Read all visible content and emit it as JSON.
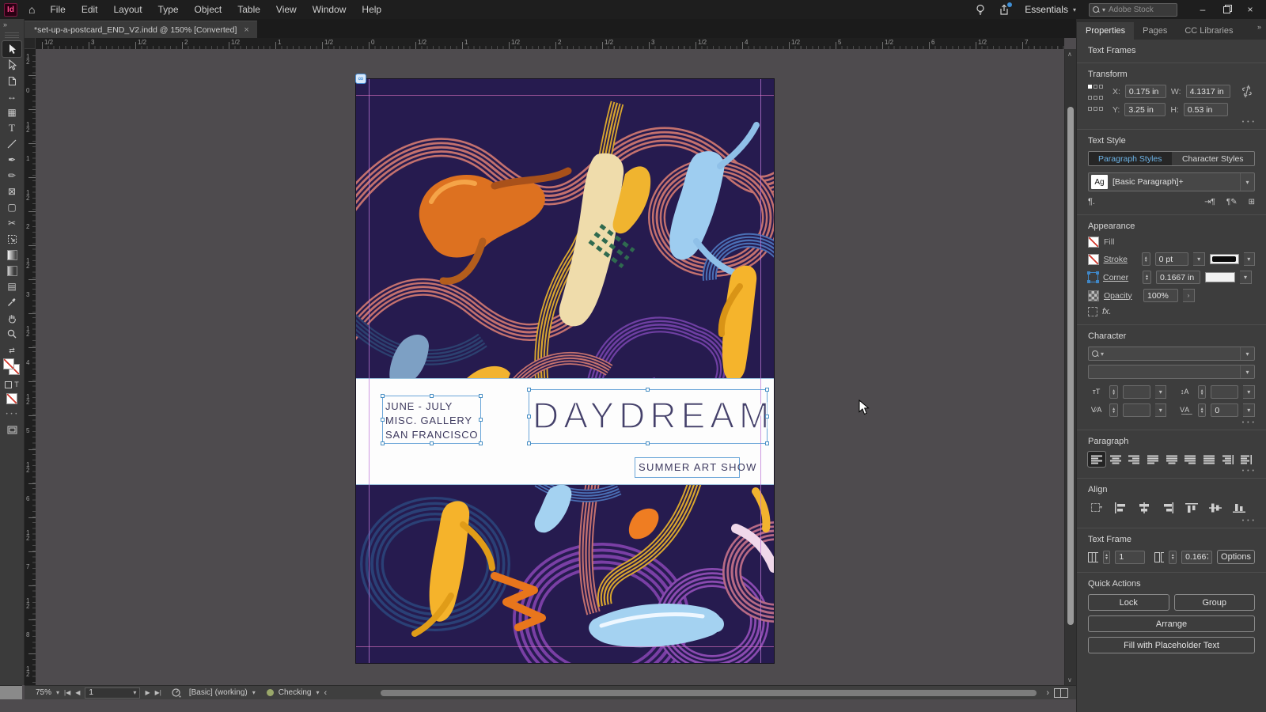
{
  "menu_bar": {
    "menus": [
      "File",
      "Edit",
      "Layout",
      "Type",
      "Object",
      "Table",
      "View",
      "Window",
      "Help"
    ],
    "logo_text": "Id",
    "workspace": "Essentials",
    "search_placeholder": "Adobe Stock"
  },
  "document_tab": {
    "title": "*set-up-a-postcard_END_V2.indd @ 150% [Converted]"
  },
  "rulers": {
    "top": [
      "1/2",
      "3",
      "1/2",
      "2",
      "1/2",
      "1",
      "1/2",
      "0",
      "1/2",
      "1",
      "1/2",
      "2",
      "1/2",
      "3",
      "1/2",
      "4",
      "1/2",
      "5",
      "1/2",
      "6",
      "1/2",
      "7",
      "1/2"
    ],
    "left": [
      "1\n2",
      "0",
      "1\n2",
      "1",
      "1\n2",
      "2",
      "1\n2",
      "3",
      "1\n2",
      "4",
      "1\n2",
      "5",
      "1\n2",
      "6",
      "1\n2",
      "7",
      "1\n2",
      "8",
      "1\n2"
    ]
  },
  "postcard": {
    "date_line": "JUNE - JULY",
    "venue_line": "MISC. GALLERY",
    "city_line": "SAN FRANCISCO",
    "title": "DAYDREAM",
    "subtitle": "SUMMER ART SHOW"
  },
  "panel": {
    "tabs": {
      "properties": "Properties",
      "pages": "Pages",
      "cc_libraries": "CC Libraries"
    },
    "selection_label": "Text Frames",
    "transform": {
      "title": "Transform",
      "x_label": "X:",
      "x": "0.175 in",
      "y_label": "Y:",
      "y": "3.25 in",
      "w_label": "W:",
      "w": "4.1317 in",
      "h_label": "H:",
      "h": "0.53 in"
    },
    "text_style": {
      "title": "Text Style",
      "tab_paragraph": "Paragraph Styles",
      "tab_character": "Character Styles",
      "style_badge": "Ag",
      "style_name": "[Basic Paragraph]+"
    },
    "appearance": {
      "title": "Appearance",
      "fill_label": "Fill",
      "stroke_label": "Stroke",
      "stroke_value": "0 pt",
      "corner_label": "Corner",
      "corner_value": "0.1667 in",
      "opacity_label": "Opacity",
      "opacity_value": "100%"
    },
    "character": {
      "title": "Character",
      "tracking_value": "0"
    },
    "paragraph": {
      "title": "Paragraph"
    },
    "align": {
      "title": "Align"
    },
    "text_frame": {
      "title": "Text Frame",
      "columns_value": "1",
      "gutter_value": "0.1667",
      "options_label": "Options"
    },
    "quick_actions": {
      "title": "Quick Actions",
      "lock": "Lock",
      "group": "Group",
      "arrange": "Arrange",
      "fill_placeholder": "Fill with Placeholder Text"
    }
  },
  "status_bar": {
    "zoom_level": "75%",
    "page_number": "1",
    "preset": "[Basic] (working)",
    "preflight_status": "Checking"
  },
  "glyphs": {
    "chev_down": "▾",
    "dbl_chev": "»",
    "close": "×",
    "minimize": "–",
    "home": "⌂",
    "cc_link": "∞",
    "arrow_left": "◀",
    "arrow_right": "▶",
    "first_bar": "|◀",
    "last_bar": "▶|",
    "angle_left": "‹",
    "angle_right": "›",
    "caret_up": "∧",
    "caret_down": "∨",
    "dots": "• • •",
    "swap": "⇄",
    "up": "▲",
    "down": "▼",
    "para_mark": "¶.",
    "para_in": "⇥¶",
    "para_edit": "¶✎",
    "para_plus": "⊞",
    "type_tool": "T",
    "gap_tool": "↔",
    "collector_tool": "▦",
    "pen_tool": "✒",
    "pencil_tool": "✏",
    "frame_tool": "⊠",
    "rect_tool": "▢",
    "scissors_tool": "✂",
    "note_tool": "▤",
    "fx": "fx.",
    "size_icon": "тT",
    "leading_icon": "↕A",
    "kern_icon": "V∕A",
    "track_icon": "V͟A͟"
  },
  "colors": {
    "accent_blue": "#3f8fd6",
    "style_link_blue": "#6cb3e6",
    "selection_frame": "#6aa5d8",
    "guide_pink": "#e078c8",
    "art_background": "#261b4f",
    "logo_pink": "#ff4b8d",
    "status_green": "#9aa86a",
    "none_swatch_red": "#d23a2e"
  }
}
